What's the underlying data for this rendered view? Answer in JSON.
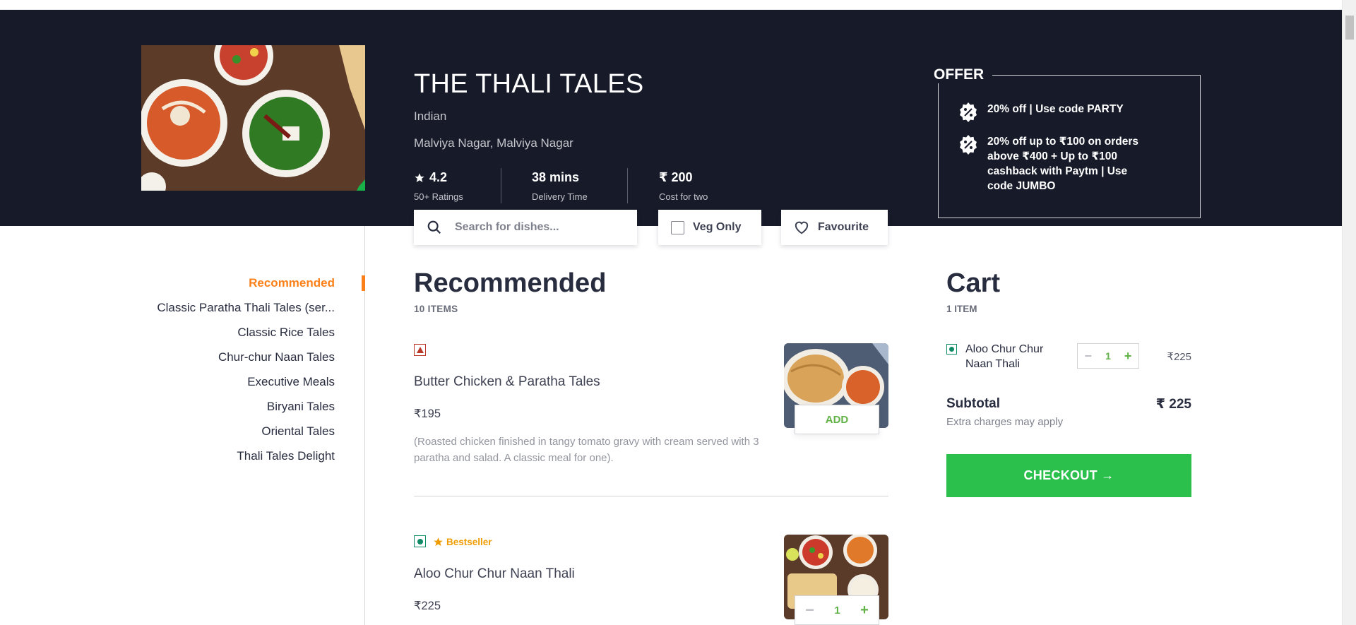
{
  "restaurant": {
    "name": "THE THALI TALES",
    "cuisine": "Indian",
    "area": "Malviya Nagar, Malviya Nagar",
    "rating": "4.2",
    "rating_label": "50+ Ratings",
    "delivery_time": "38 mins",
    "delivery_label": "Delivery Time",
    "cost": "₹ 200",
    "cost_label": "Cost for two"
  },
  "offer": {
    "label": "OFFER",
    "items": [
      "20% off | Use code PARTY",
      "20% off up to ₹100 on orders above ₹400 + Up to ₹100 cashback with Paytm | Use code JUMBO"
    ]
  },
  "search": {
    "placeholder": "Search for dishes..."
  },
  "filters": {
    "veg_only": "Veg Only",
    "favourite": "Favourite"
  },
  "categories": [
    "Recommended",
    "Classic Paratha Thali Tales (ser...",
    "Classic Rice Tales",
    "Chur-chur Naan Tales",
    "Executive Meals",
    "Biryani Tales",
    "Oriental Tales",
    "Thali Tales Delight"
  ],
  "menu": {
    "section_title": "Recommended",
    "count": "10 ITEMS",
    "items": [
      {
        "name": "Butter Chicken & Paratha Tales",
        "price": "₹195",
        "desc": "(Roasted chicken finished in tangy tomato gravy with cream served with 3 paratha and salad. A classic meal for one).",
        "type": "non-veg",
        "action": "ADD"
      },
      {
        "name": "Aloo Chur Chur Naan Thali",
        "price": "₹225",
        "badge": "Bestseller",
        "type": "veg",
        "qty": "1"
      }
    ]
  },
  "cart": {
    "title": "Cart",
    "count": "1 ITEM",
    "item_name": "Aloo Chur Chur Naan Thali",
    "item_qty": "1",
    "item_price": "₹225",
    "subtotal_label": "Subtotal",
    "subtotal_value": "₹ 225",
    "extra_note": "Extra charges may apply",
    "checkout": "CHECKOUT →"
  },
  "colors": {
    "banner": "#171a29",
    "accent": "#fc8019",
    "green": "#60b246",
    "checkout": "#2bc04c",
    "nonveg": "#ba3727"
  },
  "icons": [
    "star-icon",
    "offer-percent-icon",
    "search-icon",
    "heart-icon",
    "veg-icon",
    "non-veg-icon",
    "minus-icon",
    "plus-icon"
  ]
}
